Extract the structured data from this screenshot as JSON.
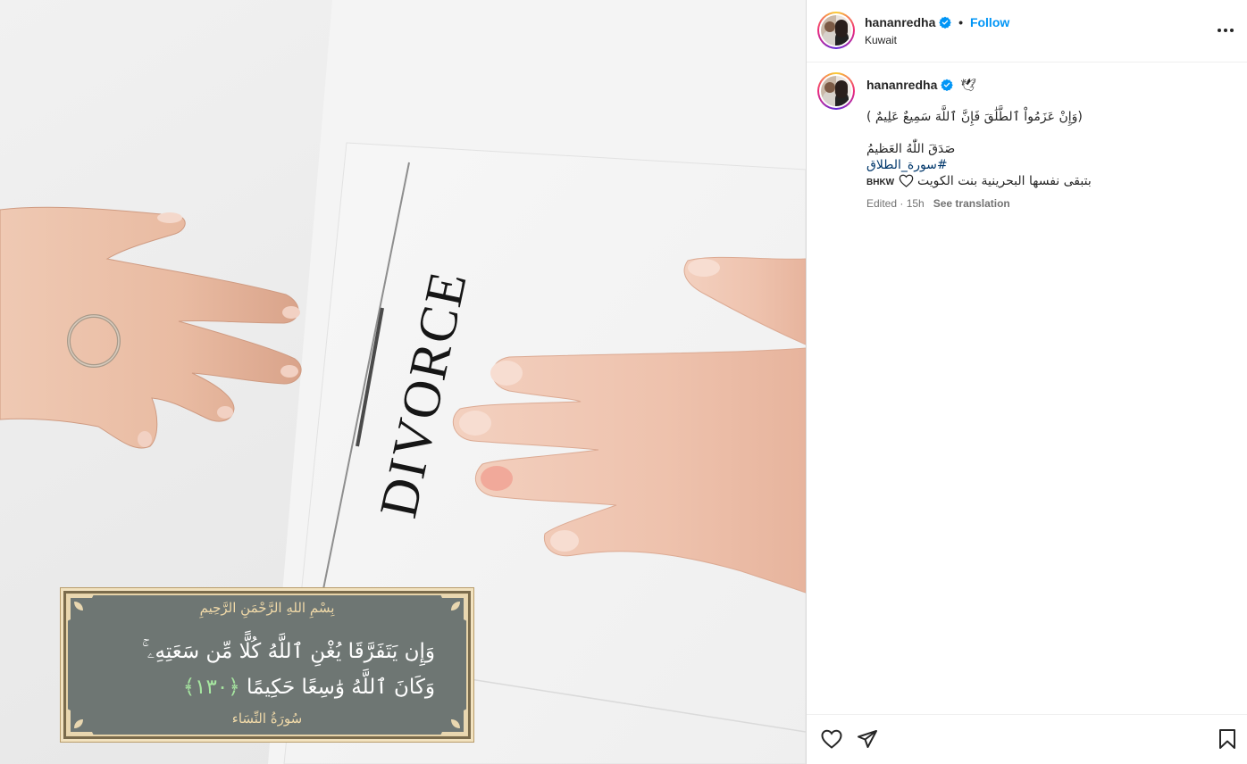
{
  "media": {
    "paper_word": "DIVORCE",
    "quran_panel": {
      "basmala": "بِسْمِ اللهِ الرَّحْمَنِ الرَّحِيمِ",
      "verse": "وَإِن يَتَفَرَّقَا يُغْنِ ٱللَّهُ كُلًّا مِّن سَعَتِهِۦ ۚ وَكَانَ ٱللَّهُ وَٰسِعًا حَكِيمًا",
      "ayah_number": "﴿١٣٠﴾",
      "surah": "سُورَةُ النِّسَاء"
    }
  },
  "header": {
    "username": "hananredha",
    "follow_label": "Follow",
    "location": "Kuwait",
    "icons": {
      "verified": "verified-badge-icon",
      "more": "more-options-icon"
    }
  },
  "caption": {
    "username": "hananredha",
    "emoji": "🕊",
    "line1": "(وَإِنْ عَزَمُواْ ٱلطَّلَٰقَ فَإِنَّ ٱللَّهَ سَمِيعٌ عَلِيمٌ )",
    "line2": "صَدَقَ اللّٰهُ العَظيمُ",
    "hashtag": "#سورة_الطلاق",
    "line4_text": "بتبقى نفسها البحرينية بنت الكويت",
    "line4_suffix": "BHKW",
    "edited": "Edited · 15h",
    "see_translation": "See translation"
  },
  "actions": {
    "icons": [
      "heart-icon",
      "share-icon",
      "bookmark-icon"
    ]
  },
  "colors": {
    "accent": "#0095f6",
    "hashtag": "#00376b",
    "muted": "#737373",
    "panel_bg": "#6e7673",
    "panel_gold": "#f0d9a8",
    "ayah_green": "#a6e6a0"
  }
}
